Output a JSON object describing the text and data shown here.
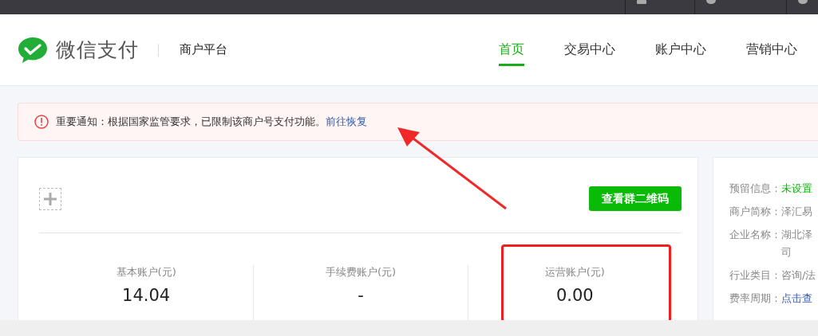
{
  "header": {
    "brand": "微信支付",
    "subtitle": "商户平台",
    "nav": [
      {
        "label": "首页",
        "selected": true
      },
      {
        "label": "交易中心",
        "selected": false
      },
      {
        "label": "账户中心",
        "selected": false
      },
      {
        "label": "营销中心",
        "selected": false
      }
    ]
  },
  "notice": {
    "text": "重要通知：根据国家监管要求，已限制该商户号支付功能。",
    "link": "前往恢复"
  },
  "main": {
    "qr_button": "查看群二维码",
    "accounts": [
      {
        "label": "基本账户(元)",
        "value": "14.04",
        "highlighted": false
      },
      {
        "label": "手续费账户(元)",
        "value": "-",
        "highlighted": false
      },
      {
        "label": "运营账户(元)",
        "value": "0.00",
        "highlighted": true
      }
    ]
  },
  "info": [
    {
      "label": "预留信息：",
      "value": "未设置",
      "kind": "status"
    },
    {
      "label": "商户简称：",
      "value": "泽汇易",
      "kind": "text"
    },
    {
      "label": "企业名称：",
      "value": "湖北泽司",
      "kind": "text"
    },
    {
      "label": "行业类目：",
      "value": "咨询/法",
      "kind": "text"
    },
    {
      "label": "费率周期：",
      "value": "点击查",
      "kind": "link"
    }
  ]
}
